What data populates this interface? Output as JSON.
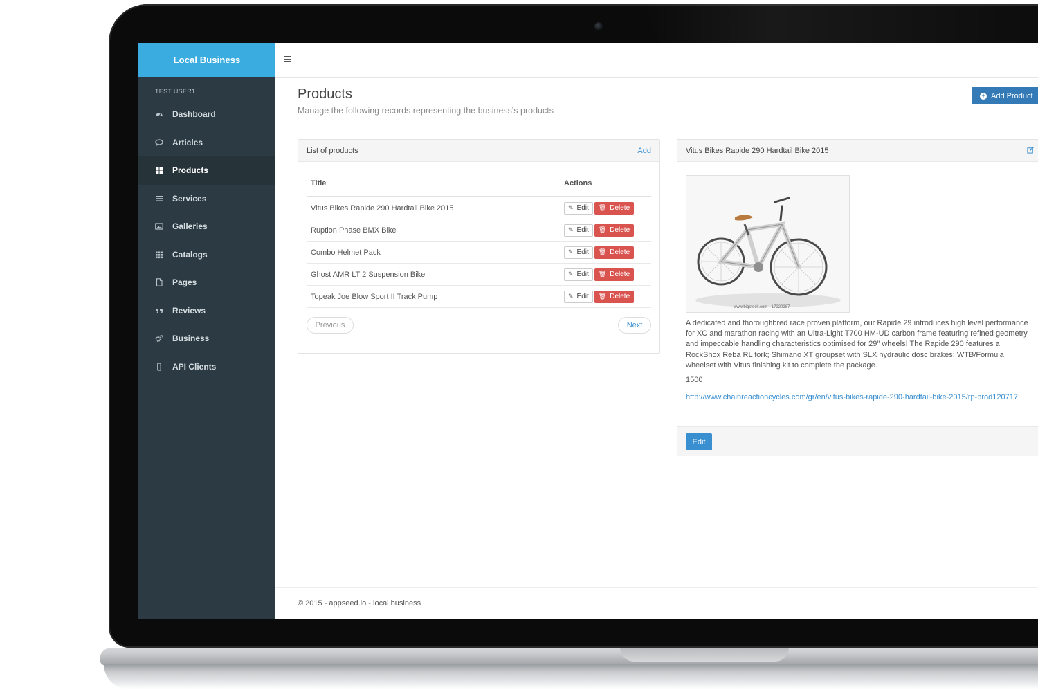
{
  "app": {
    "brand": "Local Business",
    "user": "TEST USER1"
  },
  "sidebar": {
    "items": [
      {
        "label": "Dashboard",
        "icon": "dashboard-icon"
      },
      {
        "label": "Articles",
        "icon": "comments-icon"
      },
      {
        "label": "Products",
        "icon": "grid-icon",
        "active": true
      },
      {
        "label": "Services",
        "icon": "list-icon"
      },
      {
        "label": "Galleries",
        "icon": "picture-icon"
      },
      {
        "label": "Catalogs",
        "icon": "th-icon"
      },
      {
        "label": "Pages",
        "icon": "file-icon"
      },
      {
        "label": "Reviews",
        "icon": "quote-icon"
      },
      {
        "label": "Business",
        "icon": "cogs-icon"
      },
      {
        "label": "API Clients",
        "icon": "mobile-icon"
      }
    ]
  },
  "header": {
    "title": "Products",
    "subtitle": "Manage the following records representing the business's products",
    "add_button": "Add Product"
  },
  "list": {
    "title": "List of products",
    "add_link": "Add",
    "columns": {
      "title": "Title",
      "actions": "Actions"
    },
    "edit_label": "Edit",
    "delete_label": "Delete",
    "rows": [
      {
        "title": "Vitus Bikes Rapide 290 Hardtail Bike 2015"
      },
      {
        "title": "Ruption Phase BMX Bike"
      },
      {
        "title": "Combo Helmet Pack"
      },
      {
        "title": "Ghost AMR LT 2 Suspension Bike"
      },
      {
        "title": "Topeak Joe Blow Sport II Track Pump"
      }
    ],
    "prev_label": "Previous",
    "next_label": "Next"
  },
  "detail": {
    "title": "Vitus Bikes Rapide 290 Hardtail Bike 2015",
    "image_caption": "www.bigstock.com · 17220287",
    "description": "A dedicated and thoroughbred race proven platform, our Rapide 29 introduces high level performance for XC and marathon racing with an Ultra-Light T700 HM-UD carbon frame featuring refined geometry and impeccable handling characteristics optimised for 29\" wheels! The Rapide 290 features a RockShox Reba RL fork; Shimano XT groupset with SLX hydraulic dosc brakes; WTB/Formula wheelset with Vitus finishing kit to complete the package.",
    "price": "1500",
    "url": "http://www.chainreactioncycles.com/gr/en/vitus-bikes-rapide-290-hardtail-bike-2015/rp-prod120717",
    "edit_button": "Edit"
  },
  "footer": {
    "text": "© 2015 - appseed.io - local business"
  },
  "colors": {
    "brand": "#3aace0",
    "sidebar": "#2c3b43",
    "primary": "#337ab7",
    "danger": "#d9534f",
    "link": "#3a8fd0"
  }
}
